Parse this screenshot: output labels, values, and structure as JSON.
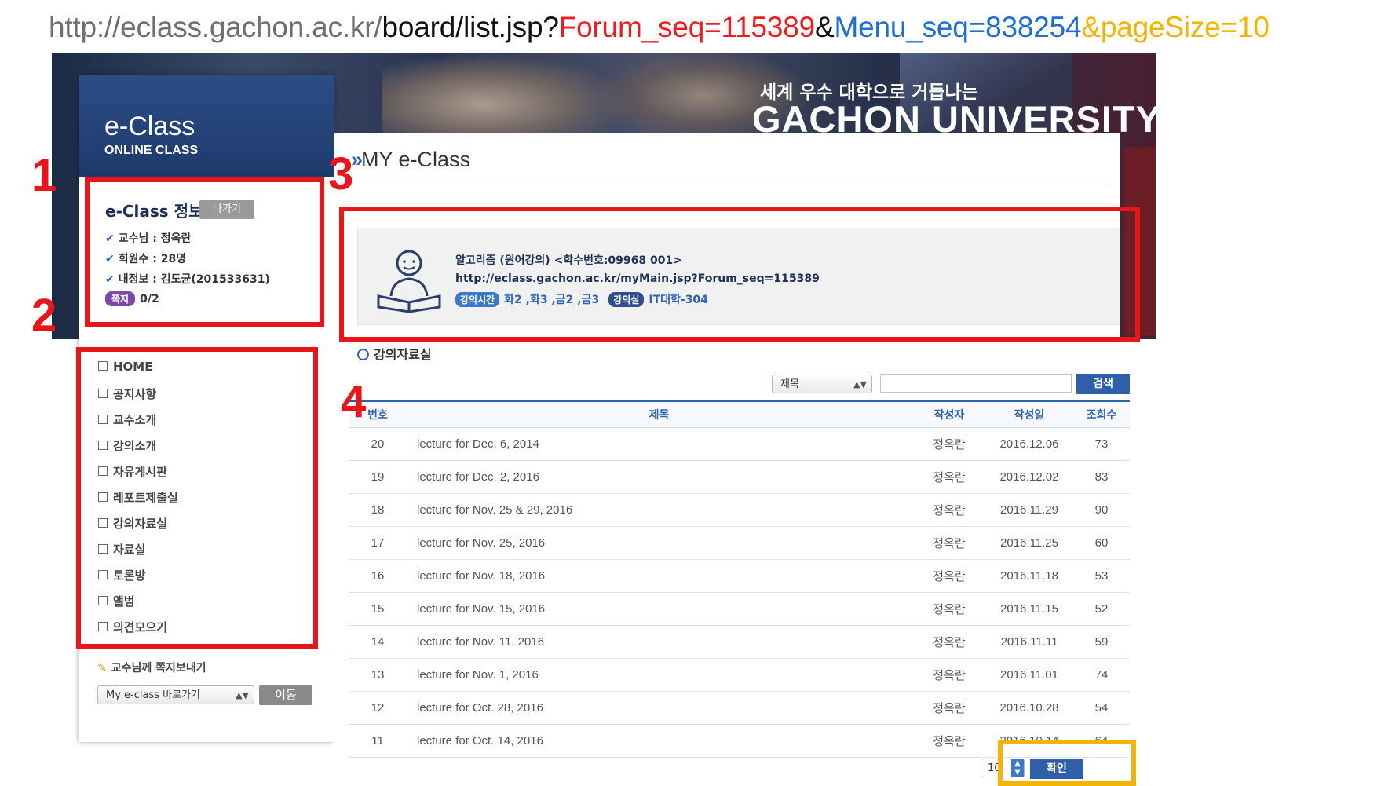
{
  "url": {
    "host": "http://eclass.gachon.ac.kr/",
    "path": "board/list.jsp?",
    "param1": "Forum_seq=115389",
    "amp1": "&",
    "param2": "Menu_seq=838254",
    "amp2": "&",
    "param3": "pageSize=10"
  },
  "banner": {
    "slogan": "세계 우수 대학으로 거듭나는",
    "university": "GACHON UNIVERSITY"
  },
  "sidebar": {
    "brand_title": "e-Class",
    "brand_sub": "ONLINE CLASS",
    "info": {
      "title": "e-Class 정보",
      "exit_label": "나가기",
      "professor": "교수님 : 정옥란",
      "members": "회원수 : 28명",
      "my_info": "내정보 : 김도균(201533631)",
      "memo_label": "쪽지",
      "memo_count": "0/2"
    },
    "menu": [
      "HOME",
      "공지사항",
      "교수소개",
      "강의소개",
      "자유게시판",
      "레포트제출실",
      "강의자료실",
      "자료실",
      "토론방",
      "앨범",
      "의견모으기"
    ],
    "note_link": "교수님께 쪽지보내기",
    "goto_select": "My e-class 바로가기",
    "goto_button": "이동"
  },
  "main": {
    "heading": "MY e-Class",
    "course": {
      "title": "알고리즘 (원어강의) <학수번호:09968 001>",
      "url": "http://eclass.gachon.ac.kr/myMain.jsp?Forum_seq=115389",
      "time_label": "강의시간",
      "time": "화2 ,화3 ,금2 ,금3",
      "room_label": "강의실",
      "room": "IT대학-304"
    },
    "section_title": "강의자료실",
    "search": {
      "field": "제목",
      "button": "검색"
    },
    "table": {
      "headers": [
        "번호",
        "제목",
        "작성자",
        "작성일",
        "조회수"
      ],
      "rows": [
        [
          "20",
          "lecture for Dec. 6, 2014",
          "정옥란",
          "2016.12.06",
          "73"
        ],
        [
          "19",
          "lecture for Dec. 2, 2016",
          "정옥란",
          "2016.12.02",
          "83"
        ],
        [
          "18",
          "lecture for Nov. 25 & 29, 2016",
          "정옥란",
          "2016.11.29",
          "90"
        ],
        [
          "17",
          "lecture for Nov. 25, 2016",
          "정옥란",
          "2016.11.25",
          "60"
        ],
        [
          "16",
          "lecture for Nov. 18, 2016",
          "정옥란",
          "2016.11.18",
          "53"
        ],
        [
          "15",
          "lecture for Nov. 15, 2016",
          "정옥란",
          "2016.11.15",
          "52"
        ],
        [
          "14",
          "lecture for Nov. 11, 2016",
          "정옥란",
          "2016.11.11",
          "59"
        ],
        [
          "13",
          "lecture for Nov. 1, 2016",
          "정옥란",
          "2016.11.01",
          "74"
        ],
        [
          "12",
          "lecture for Oct. 28, 2016",
          "정옥란",
          "2016.10.28",
          "54"
        ],
        [
          "11",
          "lecture for Oct. 14, 2016",
          "정옥란",
          "2016.10.14",
          "64"
        ]
      ]
    },
    "page_size": "10",
    "confirm_button": "확인"
  },
  "annotations": [
    "1",
    "2",
    "3",
    "4"
  ],
  "colors": {
    "highlight_red": "#e8151b",
    "highlight_yellow": "#f5b400",
    "accent_blue": "#2e5fa8"
  }
}
